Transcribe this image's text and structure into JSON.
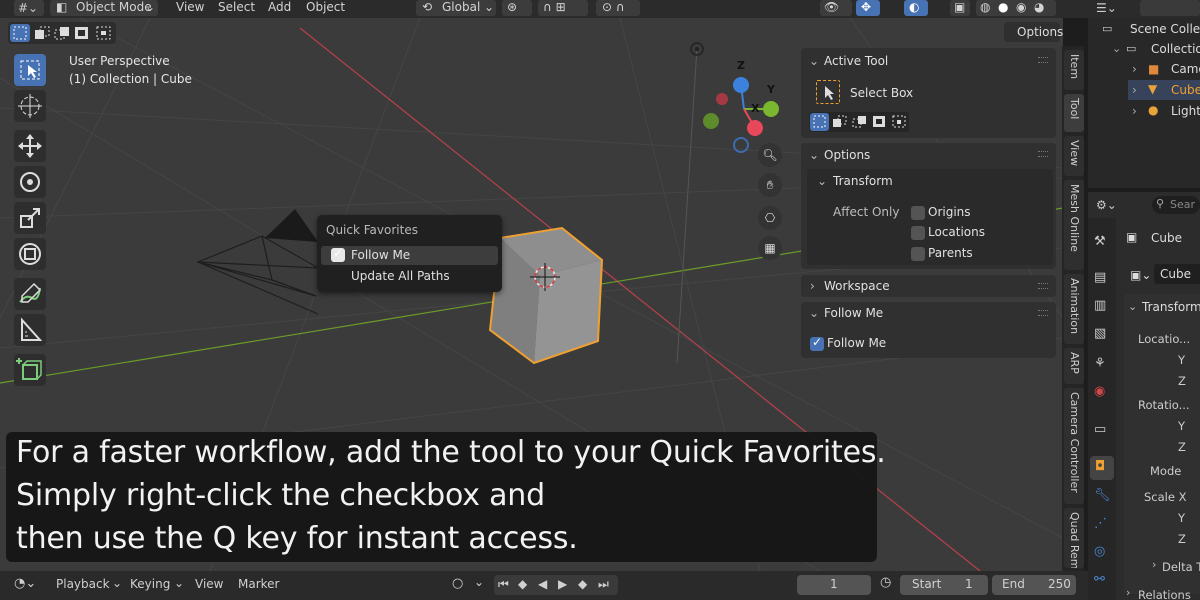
{
  "header": {
    "mode_label": "Object Mode",
    "menus": [
      "View",
      "Select",
      "Add",
      "Object"
    ],
    "orientation_label": "Global",
    "options_label": "Options"
  },
  "viewport": {
    "perspective_label": "User Perspective",
    "collection_label": "(1) Collection | Cube",
    "gizmo": {
      "z": "Z",
      "y": "Y",
      "x": "X"
    }
  },
  "quick_favorites": {
    "title": "Quick Favorites",
    "items": [
      {
        "label": "Follow Me",
        "checked": true
      },
      {
        "label": "Update All Paths"
      }
    ]
  },
  "npanel": {
    "active_tool": {
      "header": "Active Tool",
      "tool_name": "Select Box"
    },
    "options": {
      "header": "Options",
      "transform_header": "Transform",
      "affect_only_label": "Affect Only",
      "checkboxes": [
        {
          "label": "Origins",
          "checked": false
        },
        {
          "label": "Locations",
          "checked": false
        },
        {
          "label": "Parents",
          "checked": false
        }
      ]
    },
    "workspace_header": "Workspace",
    "follow_me_header": "Follow Me",
    "follow_me_checkbox": {
      "label": "Follow Me",
      "checked": true
    }
  },
  "vertical_tabs": [
    "Item",
    "Tool",
    "View",
    "Mesh Online",
    "Animation",
    "ARP",
    "Camera Controller",
    "Quad Rem"
  ],
  "outliner": {
    "scene_label": "Scene Collec",
    "collection_label": "Collection",
    "items": [
      "Came",
      "Cube",
      "Light"
    ],
    "colors": {
      "camera": "#e0893c",
      "cube": "#e8a33a",
      "light": "#e8a33a"
    }
  },
  "properties": {
    "search_placeholder": "Sear",
    "object_name": "Cube",
    "object_field": "Cube",
    "transform_label": "Transform",
    "rows": [
      "Locatio...",
      "Y",
      "Z",
      "Rotatio...",
      "Y",
      "Z",
      "Mode",
      "Scale X",
      "Y",
      "Z"
    ],
    "delta_label": "Delta T",
    "relations_label": "Relations"
  },
  "subtitle": {
    "lines": [
      "For a faster workflow, add the tool to your Quick Favorites.",
      "Simply right-click the checkbox and",
      "then use the Q key for instant access."
    ]
  },
  "timeline": {
    "playback_label": "Playback",
    "keying_label": "Keying",
    "view_label": "View",
    "marker_label": "Marker",
    "current_frame": "1",
    "start_label": "Start",
    "start_value": "1",
    "end_label": "End",
    "end_value": "250"
  },
  "colors": {
    "accent": "#4772b3",
    "selection_orange": "#f0a030",
    "axis_x": "#e8485a",
    "axis_y": "#7ab62e",
    "axis_z": "#3c82dc"
  }
}
